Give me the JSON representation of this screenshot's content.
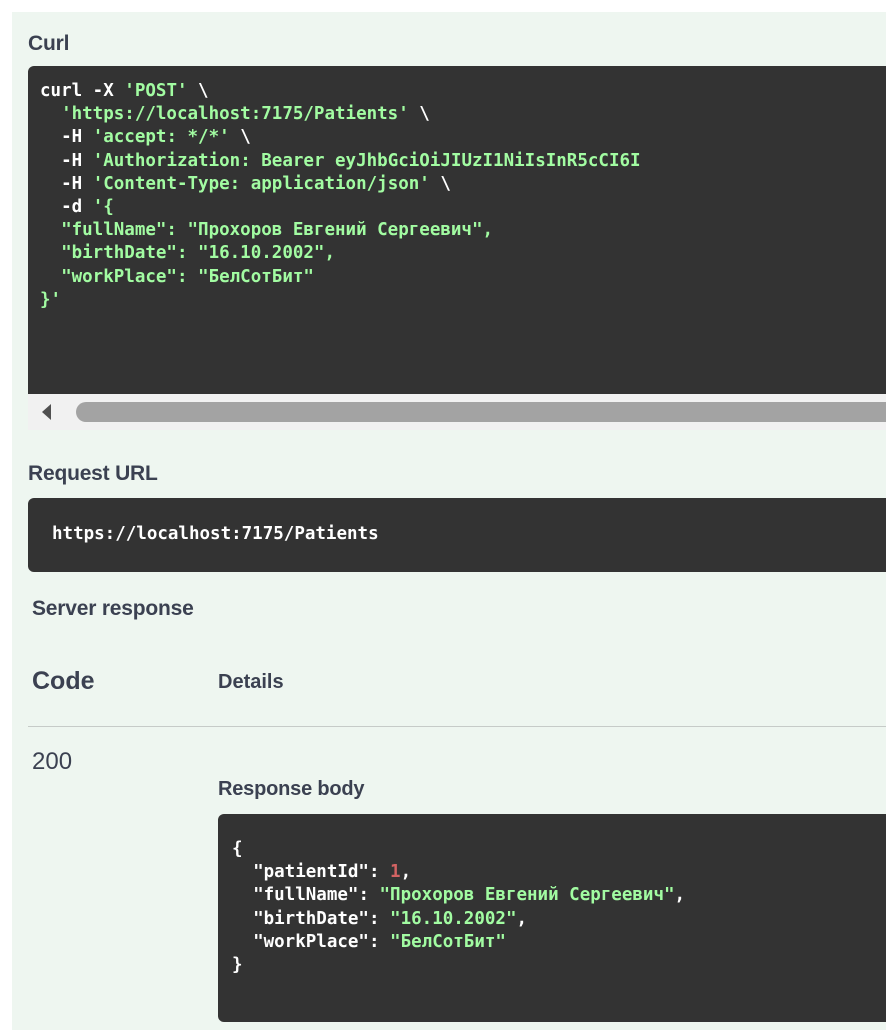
{
  "curl": {
    "label": "Curl",
    "lines": [
      [
        {
          "t": "curl -X ",
          "c": "wht"
        },
        {
          "t": "'POST'",
          "c": "str"
        },
        {
          "t": " \\",
          "c": "wht"
        }
      ],
      [
        {
          "t": "  'https://localhost:7175/Patients'",
          "c": "str"
        },
        {
          "t": " \\",
          "c": "wht"
        }
      ],
      [
        {
          "t": "  -H ",
          "c": "wht"
        },
        {
          "t": "'accept: */*'",
          "c": "str"
        },
        {
          "t": " \\",
          "c": "wht"
        }
      ],
      [
        {
          "t": "  -H ",
          "c": "wht"
        },
        {
          "t": "'Authorization: Bearer eyJhbGciOiJIUzI1NiIsInR5cCI6I",
          "c": "str"
        }
      ],
      [
        {
          "t": "  -H ",
          "c": "wht"
        },
        {
          "t": "'Content-Type: application/json'",
          "c": "str"
        },
        {
          "t": " \\",
          "c": "wht"
        }
      ],
      [
        {
          "t": "  -d ",
          "c": "wht"
        },
        {
          "t": "'{",
          "c": "str"
        }
      ],
      [
        {
          "t": "  \"fullName\": \"Прохоров Евгений Сергеевич\",",
          "c": "str"
        }
      ],
      [
        {
          "t": "  \"birthDate\": \"16.10.2002\",",
          "c": "str"
        }
      ],
      [
        {
          "t": "  \"workPlace\": \"БелСотБит\"",
          "c": "str"
        }
      ],
      [
        {
          "t": "}'",
          "c": "str"
        }
      ]
    ]
  },
  "request_url": {
    "label": "Request URL",
    "value": "https://localhost:7175/Patients"
  },
  "server_response": {
    "label": "Server response",
    "code_header": "Code",
    "details_header": "Details",
    "status_code": "200",
    "response_body_label": "Response body",
    "body_lines": [
      [
        {
          "t": "{",
          "c": "wht"
        }
      ],
      [
        {
          "t": "  \"patientId\"",
          "c": "wht"
        },
        {
          "t": ": ",
          "c": "wht"
        },
        {
          "t": "1",
          "c": "num"
        },
        {
          "t": ",",
          "c": "wht"
        }
      ],
      [
        {
          "t": "  \"fullName\"",
          "c": "wht"
        },
        {
          "t": ": ",
          "c": "wht"
        },
        {
          "t": "\"Прохоров Евгений Сергеевич\"",
          "c": "str"
        },
        {
          "t": ",",
          "c": "wht"
        }
      ],
      [
        {
          "t": "  \"birthDate\"",
          "c": "wht"
        },
        {
          "t": ": ",
          "c": "wht"
        },
        {
          "t": "\"16.10.2002\"",
          "c": "str"
        },
        {
          "t": ",",
          "c": "wht"
        }
      ],
      [
        {
          "t": "  \"workPlace\"",
          "c": "wht"
        },
        {
          "t": ": ",
          "c": "wht"
        },
        {
          "t": "\"БелСотБит\"",
          "c": "str"
        }
      ],
      [
        {
          "t": "}",
          "c": "wht"
        }
      ]
    ]
  },
  "colors": {
    "panel_bg": "#eef6f0",
    "code_bg": "#333333",
    "string": "#a2fca2",
    "number": "#d36363",
    "label_text": "#3b4151"
  },
  "icons": {
    "scroll_left": "scroll-left-arrow-icon"
  }
}
